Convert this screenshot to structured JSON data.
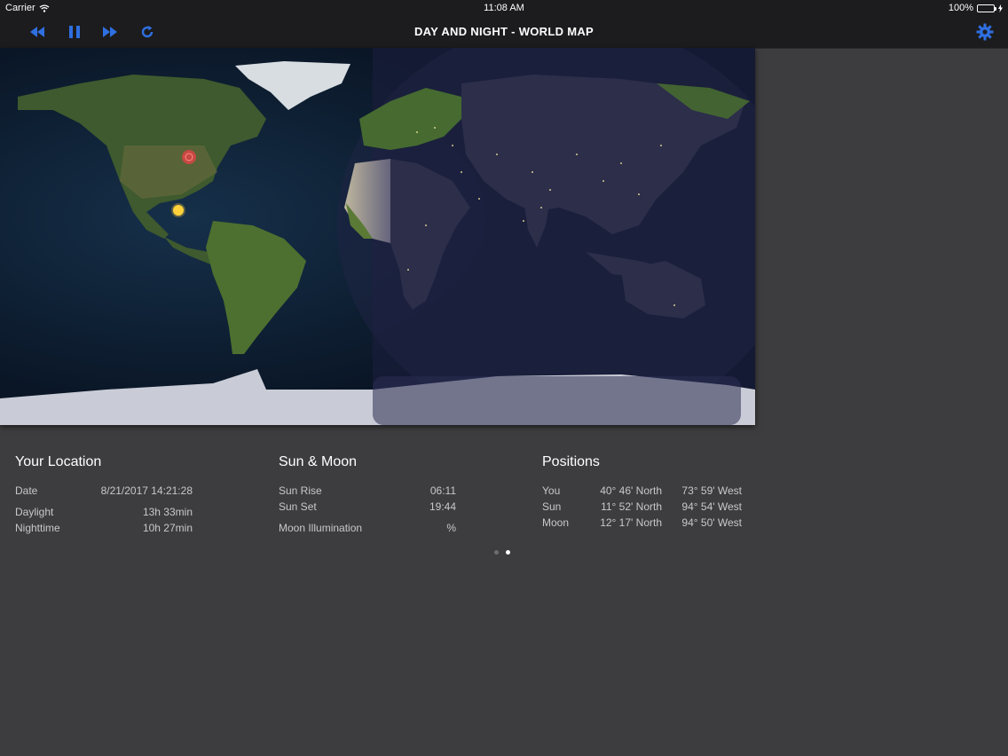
{
  "status": {
    "carrier": "Carrier",
    "time": "11:08 AM",
    "battery": "100%"
  },
  "nav": {
    "title": "DAY AND NIGHT - WORLD MAP",
    "accent": "#2f6fe0"
  },
  "icons": {
    "rewind": "rewind-icon",
    "pause": "pause-icon",
    "fast_forward": "fast-forward-icon",
    "refresh": "refresh-icon",
    "settings": "gear-icon",
    "sun": "sun-icon",
    "location": "location-marker-icon"
  },
  "location": {
    "title": "Your Location",
    "date_label": "Date",
    "date_value": "8/21/2017 14:21:28",
    "daylight_label": "Daylight",
    "daylight_value": "13h 33min",
    "nighttime_label": "Nighttime",
    "nighttime_value": "10h 27min"
  },
  "sunmoon": {
    "title": "Sun & Moon",
    "sunrise_label": "Sun Rise",
    "sunrise_value": "06:11",
    "sunset_label": "Sun Set",
    "sunset_value": "19:44",
    "moon_label": "Moon Illumination",
    "moon_value": "%"
  },
  "positions": {
    "title": "Positions",
    "rows": [
      {
        "name": "You",
        "lat": "40° 46' North",
        "lon": "73° 59' West"
      },
      {
        "name": "Sun",
        "lat": "11° 52' North",
        "lon": "94° 54' West"
      },
      {
        "name": "Moon",
        "lat": "12° 17' North",
        "lon": "94° 50' West"
      }
    ]
  },
  "pager": {
    "pages": 2,
    "active": 2
  }
}
